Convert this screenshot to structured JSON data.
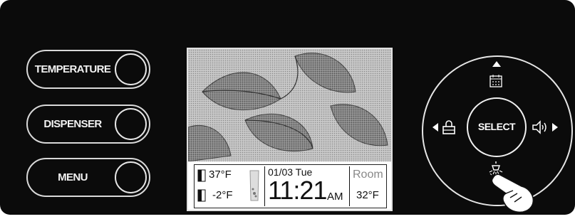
{
  "left_buttons": {
    "temperature": "TEMPERATURE",
    "dispenser": "DISPENSER",
    "menu": "MENU"
  },
  "screen": {
    "fridge_temp": "37°F",
    "freezer_temp": "-2°F",
    "date": "01/03 Tue",
    "time": "11:21",
    "ampm": "AM",
    "room_label": "Room",
    "room_temp": "32°F"
  },
  "dial": {
    "select_label": "SELECT",
    "up_icon": "calendar-icon",
    "left_icon": "lock-icon",
    "right_icon": "speaker-icon",
    "down_icon": "light-bulb-icon"
  }
}
